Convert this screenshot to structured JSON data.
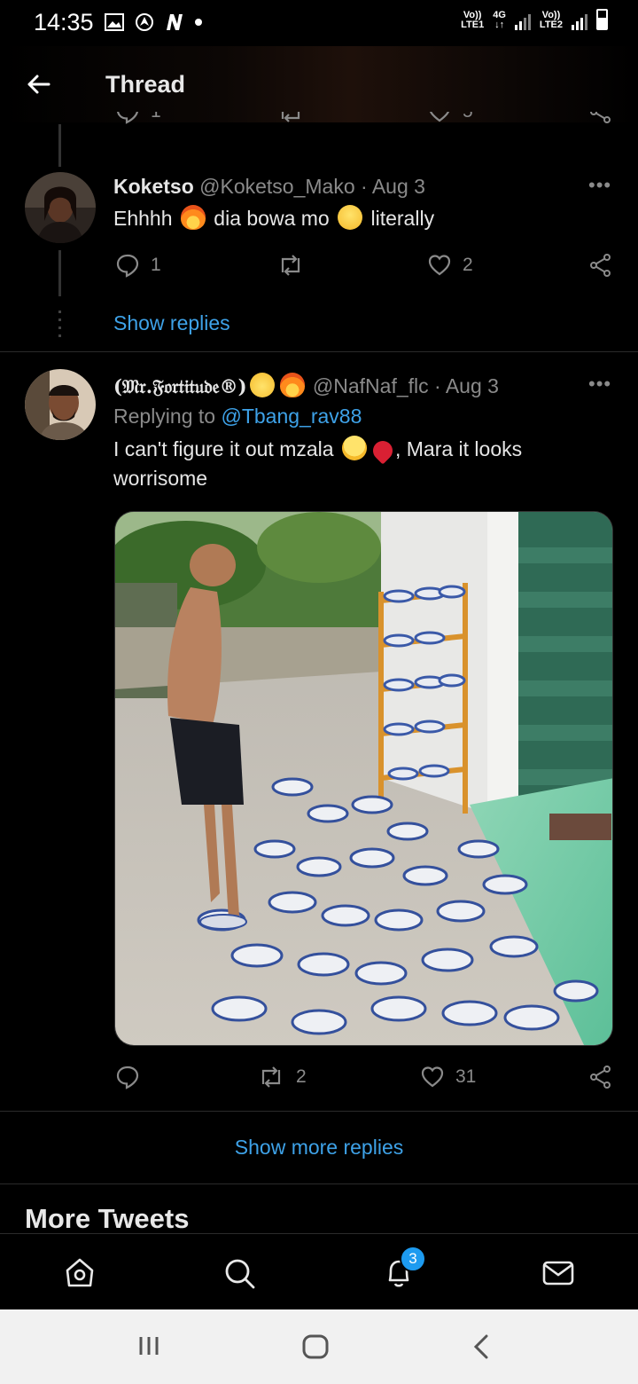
{
  "status_bar": {
    "time": "14:35",
    "net1_top": "Vo))",
    "net1_bottom": "LTE1",
    "net1_type": "4G",
    "net2_top": "Vo))",
    "net2_bottom": "LTE2",
    "battery": 0.6
  },
  "header": {
    "title": "Thread"
  },
  "partial_tweet": {
    "reply_count": "1",
    "like_count": "5"
  },
  "tweets": [
    {
      "display_name": "Koketso",
      "handle": "@Koketso_Mako",
      "separator": "·",
      "date": "Aug 3",
      "text_part1": "Ehhhh",
      "text_part2": "dia bowa mo",
      "text_part3": "literally",
      "emojis": [
        "fire-emoji",
        "sweat-smile-emoji"
      ],
      "reply_count": "1",
      "retweet_count": "",
      "like_count": "2",
      "show_replies": "Show replies"
    },
    {
      "display_name": "(𝔐𝔯.𝔉𝔬𝔯𝔱𝔦𝔱𝔲𝔡𝔢®)",
      "handle": "@NafNaf_flc",
      "separator": "·",
      "date": "Aug 3",
      "replying_prefix": "Replying to",
      "replying_to": "@Tbang_rav88",
      "text_part1": "I can't figure it out mzala",
      "text_part2": ", Mara it looks",
      "text_part3": "worrisome",
      "emojis": [
        "sunglasses-emoji",
        "fire-emoji",
        "crying-emoji",
        "broken-heart-emoji"
      ],
      "reply_count": "",
      "retweet_count": "2",
      "like_count": "31"
    }
  ],
  "show_more_replies": "Show more replies",
  "more_tweets": "More Tweets",
  "notifications_badge": "3",
  "colors": {
    "accent": "#1d9bf0",
    "link": "#3ea2e8",
    "muted": "#8a8a8a"
  }
}
